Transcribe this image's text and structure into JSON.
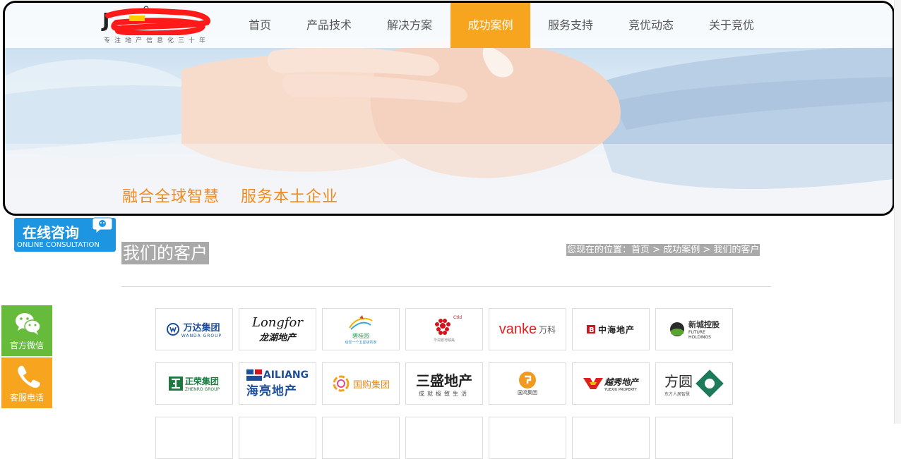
{
  "header": {
    "logo_tagline": "专注地产信息化三十年",
    "nav": [
      {
        "label": "首页",
        "active": false
      },
      {
        "label": "产品技术",
        "active": false
      },
      {
        "label": "解决方案",
        "active": false
      },
      {
        "label": "成功案例",
        "active": true
      },
      {
        "label": "服务支持",
        "active": false
      },
      {
        "label": "竞优动态",
        "active": false
      },
      {
        "label": "关于竞优",
        "active": false
      }
    ]
  },
  "banner": {
    "slogan_1": "融合全球智慧",
    "slogan_2": "服务本土企业"
  },
  "consult": {
    "title": "在线咨询",
    "subtitle": "ONLINE CONSULTATION"
  },
  "side_buttons": {
    "wechat": "官方微信",
    "phone": "客服电话"
  },
  "section": {
    "title": "我们的客户"
  },
  "breadcrumb": {
    "prefix": "您现在的位置：",
    "home": "首页",
    "sep": " > ",
    "cases": "成功案例",
    "current": "我们的客户"
  },
  "clients": [
    {
      "name": "万达集团",
      "sub": "WANDA GROUP"
    },
    {
      "name": "Longfor",
      "sub": "龙湖地产"
    },
    {
      "name": "碧桂园",
      "sub": "给您一个五星级的家"
    },
    {
      "name": "Ctld",
      "sub": "华润置地臻美"
    },
    {
      "name": "vanke",
      "sub": "万科"
    },
    {
      "name": "中海地产",
      "sub": ""
    },
    {
      "name": "新城控股",
      "sub": "FUTURE HOLDINGS"
    },
    {
      "name": "正荣集团",
      "sub": "ZHENRO GROUP"
    },
    {
      "name": "AILIANG",
      "sub": "海亮地产"
    },
    {
      "name": "国购集团",
      "sub": ""
    },
    {
      "name": "三盛地产",
      "sub": "成就极致生活"
    },
    {
      "name": "国鸿集团",
      "sub": ""
    },
    {
      "name": "越秀地产",
      "sub": "YUEXIU PROPERTY"
    },
    {
      "name": "方圆",
      "sub": "东方人居智慧"
    }
  ],
  "colors": {
    "accent": "#f7a51e",
    "slogan": "#ef8a1f",
    "consult_blue": "#1e95e0",
    "wechat_green": "#66bb3b",
    "breadcrumb_bg": "#a9a9a9"
  }
}
